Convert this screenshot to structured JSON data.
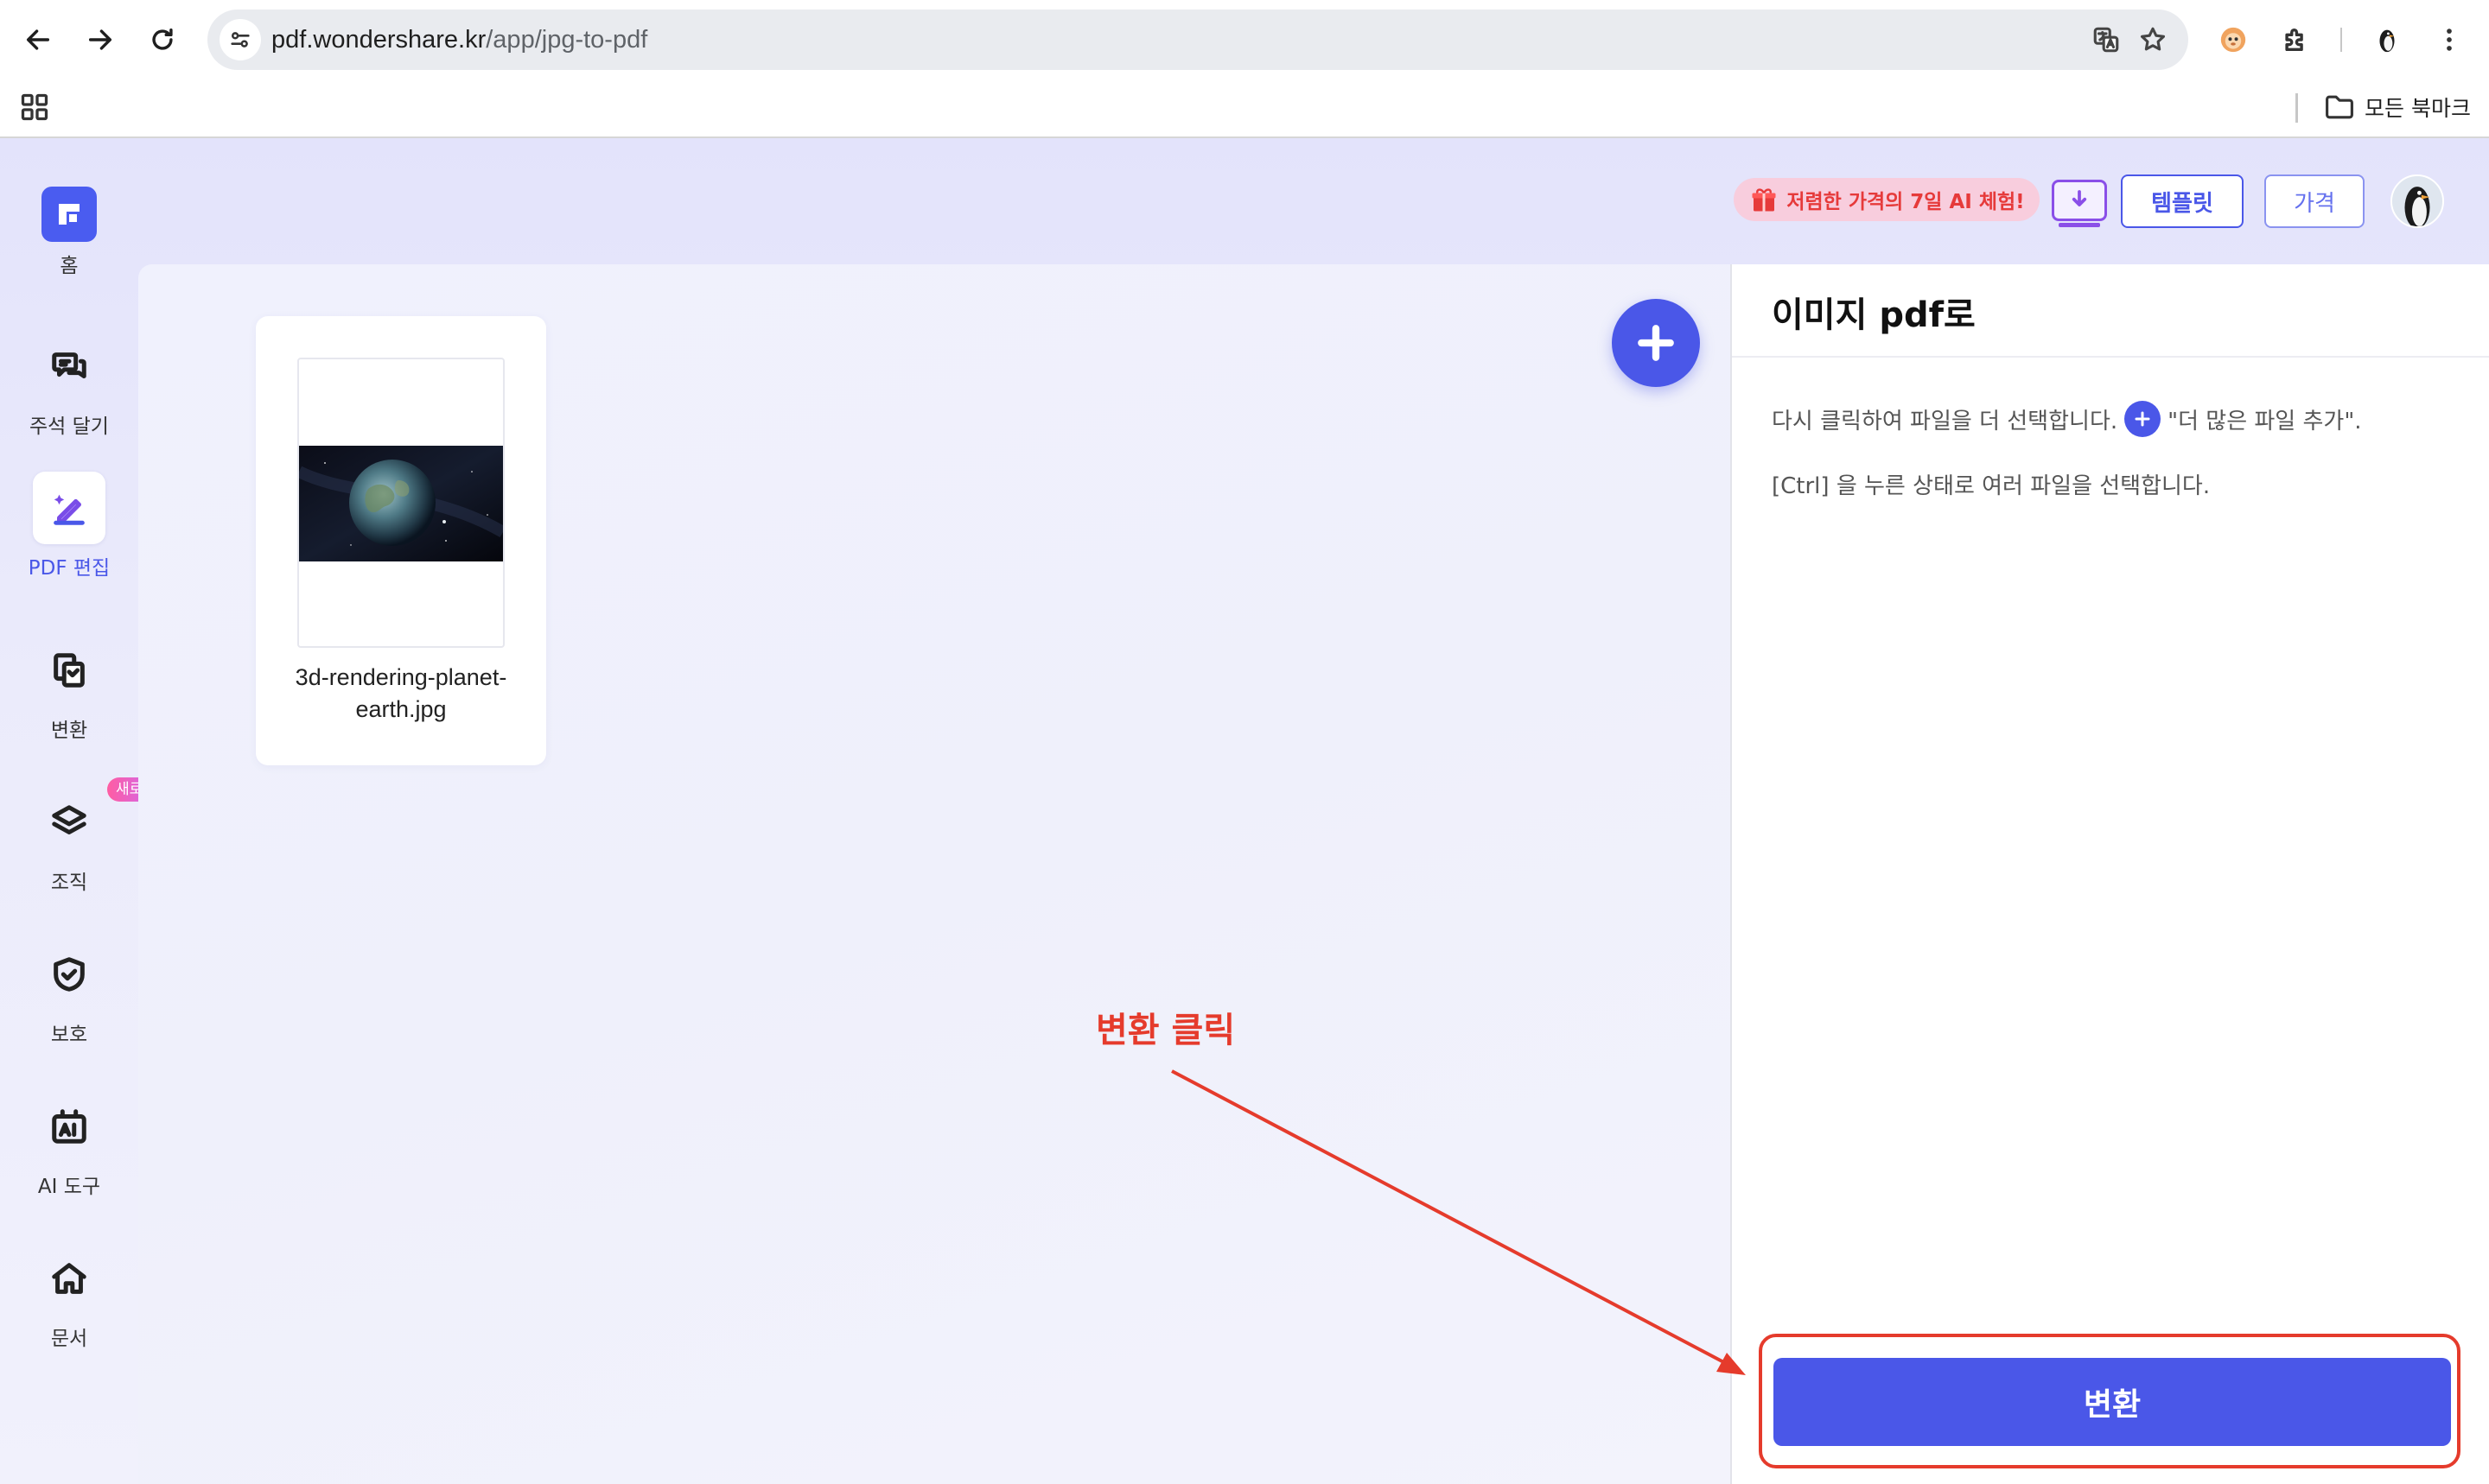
{
  "browser": {
    "url_host": "pdf.wondershare.kr",
    "url_path": "/app/jpg-to-pdf",
    "bookmarks_folder": "모든 북마크"
  },
  "sidebar": {
    "items": [
      {
        "label": "홈",
        "icon": "logo-icon"
      },
      {
        "label": "주석 달기",
        "icon": "annotate-icon"
      },
      {
        "label": "PDF 편집",
        "icon": "edit-pdf-icon"
      },
      {
        "label": "변환",
        "icon": "convert-icon"
      },
      {
        "label": "조직",
        "icon": "layers-icon",
        "badge": "새로운"
      },
      {
        "label": "보호",
        "icon": "shield-icon"
      },
      {
        "label": "AI 도구",
        "icon": "ai-tools-icon"
      },
      {
        "label": "문서",
        "icon": "home-icon"
      }
    ]
  },
  "header": {
    "promo_text": "저렴한 가격의 7일 AI 체험!",
    "template_label": "템플릿",
    "price_label": "가격"
  },
  "canvas": {
    "file_name": "3d-rendering-planet-earth.jpg"
  },
  "panel": {
    "title": "이미지 pdf로",
    "hint_before": "다시 클릭하여 파일을 더 선택합니다.",
    "hint_after": "\"더 많은 파일 추가\".",
    "hint2": "[Ctrl] 을 누른 상태로 여러 파일을 선택합니다.",
    "convert_label": "변환"
  },
  "annotation": {
    "text": "변환 클릭",
    "color": "#e53b2c"
  },
  "colors": {
    "accent": "#4a57e8",
    "promo_bg": "#f8cddd",
    "promo_text": "#e63a3a"
  }
}
